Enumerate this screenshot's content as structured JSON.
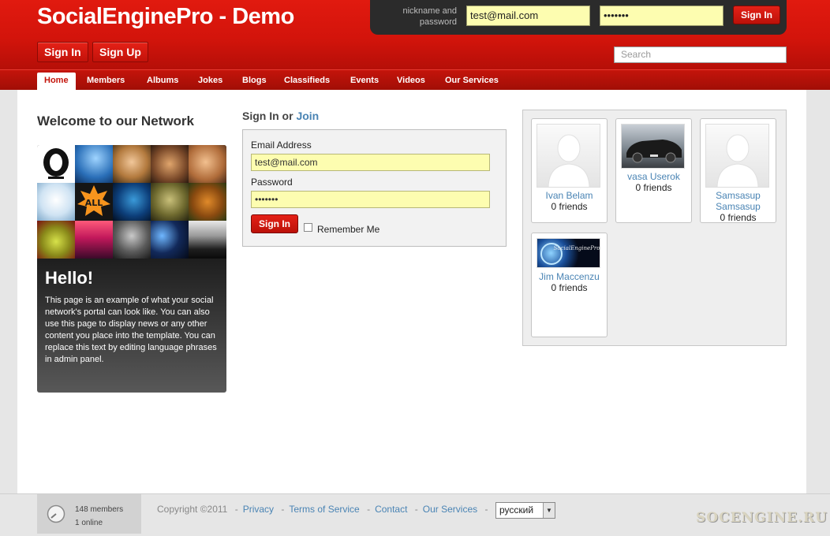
{
  "header": {
    "site_title": "SocialEnginePro - Demo",
    "signin_button": "Sign In",
    "signup_button": "Sign Up",
    "login_hint_line1": "nickname and",
    "login_hint_line2": "password",
    "login_value": "test@mail.com",
    "password_value": "•••••••",
    "mini_signin_button": "Sign In",
    "search_placeholder": "Search"
  },
  "nav": {
    "items": [
      "Home",
      "Members",
      "Albums",
      "Jokes",
      "Blogs",
      "Classifieds",
      "Events",
      "Videos",
      "Our Services"
    ],
    "active": "Home"
  },
  "welcome": {
    "title": "Welcome to our Network",
    "hello_title": "Hello!",
    "hello_text": "This page is an example of what your social network's portal can look like. You can also use this page to display news or any other content you place into the template. You can replace this text by editing language phrases in admin panel."
  },
  "signin_form": {
    "heading_prefix": "Sign In or ",
    "heading_join": "Join",
    "email_label": "Email Address",
    "email_value": "test@mail.com",
    "password_label": "Password",
    "password_value": "•••••••",
    "submit_label": "Sign In",
    "remember_label": "Remember Me"
  },
  "members": [
    {
      "name": "Ivan Belam",
      "friends": "0 friends",
      "photo": "placeholder"
    },
    {
      "name": "vasa Userok",
      "friends": "0 friends",
      "photo": "car"
    },
    {
      "name": "Samsasup Samsasup",
      "friends": "0 friends",
      "photo": "placeholder"
    },
    {
      "name": "Jim Maccenzu",
      "friends": "0 friends",
      "photo": "logo"
    }
  ],
  "footer": {
    "members_count": "148 members",
    "online_count": "1 online",
    "copyright": "Copyright ©2011",
    "links": [
      "Privacy",
      "Terms of Service",
      "Contact",
      "Our Services"
    ],
    "language": "русский",
    "watermark": "SOCENGINE.RU"
  },
  "colors": {
    "brand_red": "#d3140b",
    "link_blue": "#4a84b4",
    "input_yellow": "#fdfdb0"
  }
}
